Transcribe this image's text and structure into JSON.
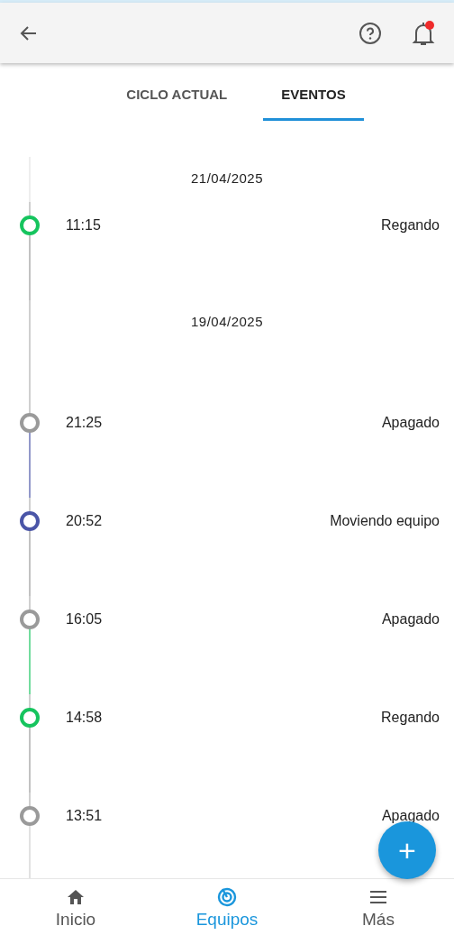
{
  "tabs": [
    {
      "label": "CICLO ACTUAL",
      "selected": false
    },
    {
      "label": "EVENTOS",
      "selected": true
    }
  ],
  "timeline": {
    "groups": [
      {
        "date": "21/04/2025",
        "events": [
          {
            "time": "11:15",
            "status": "Regando",
            "color": "#16c45e"
          }
        ]
      },
      {
        "date": "19/04/2025",
        "events": [
          {
            "time": "21:25",
            "status": "Apagado",
            "color": "#9a9a9a"
          },
          {
            "time": "20:52",
            "status": "Moviendo equipo",
            "color": "#4a55a7"
          },
          {
            "time": "16:05",
            "status": "Apagado",
            "color": "#9a9a9a"
          },
          {
            "time": "14:58",
            "status": "Regando",
            "color": "#16c45e"
          },
          {
            "time": "13:51",
            "status": "Apagado",
            "color": "#9a9a9a"
          }
        ]
      }
    ]
  },
  "fab": {
    "label": "+"
  },
  "nav": [
    {
      "label": "Inicio",
      "selected": false
    },
    {
      "label": "Equipos",
      "selected": true
    },
    {
      "label": "Más",
      "selected": false
    }
  ]
}
